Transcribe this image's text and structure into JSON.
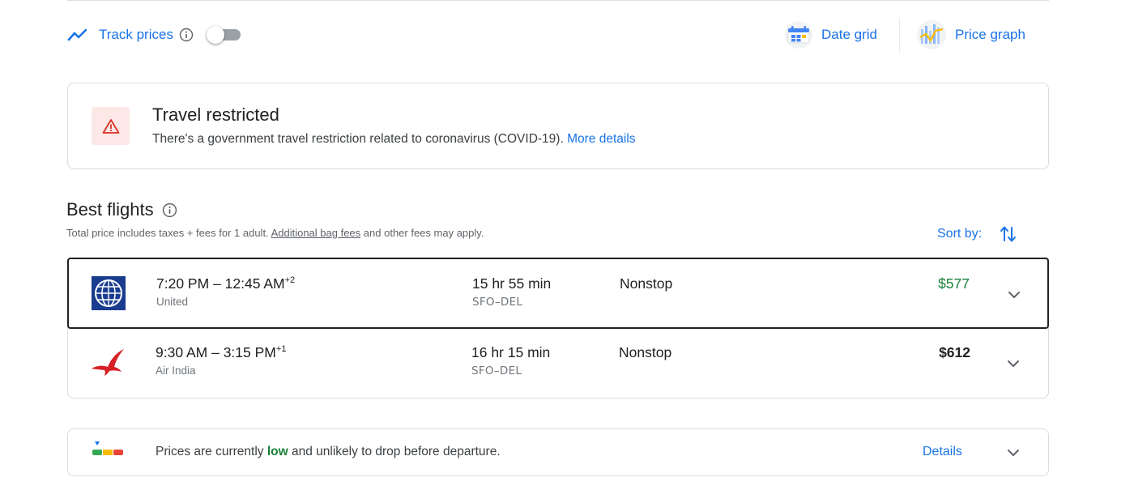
{
  "toolbar": {
    "track_prices_label": "Track prices",
    "date_grid_label": "Date grid",
    "price_graph_label": "Price graph"
  },
  "restriction": {
    "title": "Travel restricted",
    "message": "There's a government travel restriction related to coronavirus (COVID-19).",
    "link_label": "More details"
  },
  "best_flights": {
    "title": "Best flights",
    "subtitle_prefix": "Total price includes taxes + fees for 1 adult.",
    "subtitle_link": "Additional bag fees",
    "subtitle_suffix": "and other fees may apply.",
    "sort_label": "Sort by:",
    "flights": [
      {
        "depart": "7:20 PM",
        "arrive": "12:45 AM",
        "day_offset": "+2",
        "airline": "United",
        "duration": "15 hr 55 min",
        "route": "SFO–DEL",
        "stops": "Nonstop",
        "price": "$577"
      },
      {
        "depart": "9:30 AM",
        "arrive": "3:15 PM",
        "day_offset": "+1",
        "airline": "Air India",
        "duration": "16 hr 15 min",
        "route": "SFO–DEL",
        "stops": "Nonstop",
        "price": "$612"
      }
    ]
  },
  "price_insight": {
    "text_before": "Prices are currently",
    "level": "low",
    "text_after": "and unlikely to drop before departure.",
    "details_label": "Details"
  },
  "colors": {
    "link": "#1a73e8",
    "good_price": "#188038",
    "warning": "#d93025"
  }
}
